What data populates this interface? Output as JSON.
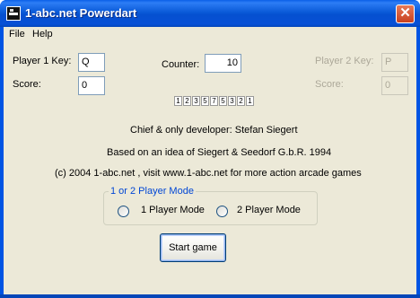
{
  "window": {
    "title": "1-abc.net Powerdart",
    "close_glyph": "✕"
  },
  "menu": {
    "items": [
      "File",
      "Help"
    ]
  },
  "player1": {
    "key_label": "Player 1 Key:",
    "key_value": "Q",
    "score_label": "Score:",
    "score_value": "0"
  },
  "counter": {
    "label": "Counter:",
    "value": "10"
  },
  "player2": {
    "key_label": "Player 2 Key:",
    "key_value": "P",
    "score_label": "Score:",
    "score_value": "0"
  },
  "digits": [
    "1",
    "2",
    "3",
    "5",
    "7",
    "5",
    "3",
    "2",
    "1"
  ],
  "credits": {
    "developer": "Chief & only developer: Stefan Siegert",
    "idea": "Based on an idea of Siegert & Seedorf G.b.R. 1994",
    "copyright": "(c) 2004 1-abc.net , visit www.1-abc.net for more action arcade games"
  },
  "mode": {
    "group_title": "1 or 2 Player Mode",
    "option1": "1 Player Mode",
    "option2": "2 Player Mode"
  },
  "start_button": "Start game",
  "colors": {
    "titlebar": "#0054e3",
    "client_bg": "#ece9d8",
    "group_title": "#0046d5",
    "close_btn": "#c8401e"
  }
}
